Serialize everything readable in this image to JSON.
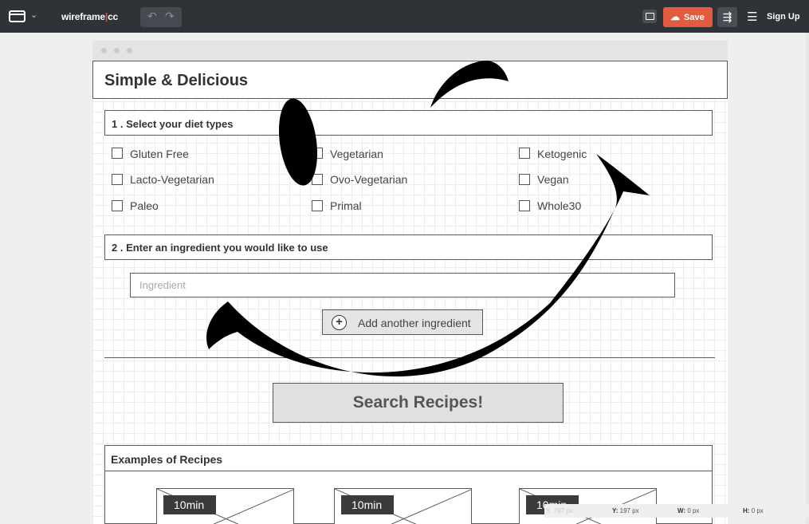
{
  "app": {
    "brand_main": "wireframe",
    "brand_cc": "cc",
    "save_label": "Save",
    "signup_label": "Sign Up"
  },
  "page": {
    "title": "Simple & Delicious"
  },
  "diet_section": {
    "label": "1 . Select your diet types",
    "options": [
      "Gluten Free",
      "Vegetarian",
      "Ketogenic",
      "Lacto-Vegetarian",
      "Ovo-Vegetarian",
      "Vegan",
      "Paleo",
      "Primal",
      "Whole30"
    ]
  },
  "ingredient_section": {
    "label": "2 . Enter an ingredient you would like to use",
    "input_placeholder": "Ingredient",
    "input_value": "",
    "add_button_label": "Add another ingredient"
  },
  "search_button_label": "Search Recipes!",
  "examples": {
    "label": "Examples of Recipes",
    "cards": [
      {
        "time": "10min"
      },
      {
        "time": "10min"
      },
      {
        "time": "10min"
      }
    ]
  },
  "status": {
    "x": "X: 797 px",
    "y_key": "Y:",
    "y_val": "197 px",
    "w_key": "W:",
    "w_val": "0 px",
    "h_key": "H:",
    "h_val": "0 px"
  },
  "icons": {
    "window": "window-icon",
    "undo": "undo-icon",
    "redo": "redo-icon",
    "comment": "comment-icon",
    "save": "cloud-upload-icon",
    "settings": "sliders-icon",
    "menu": "hamburger-menu-icon",
    "add": "plus-circle-icon"
  },
  "colors": {
    "topbar": "#2f3237",
    "save_button": "#e25b3e",
    "canvas": "#efefef"
  }
}
